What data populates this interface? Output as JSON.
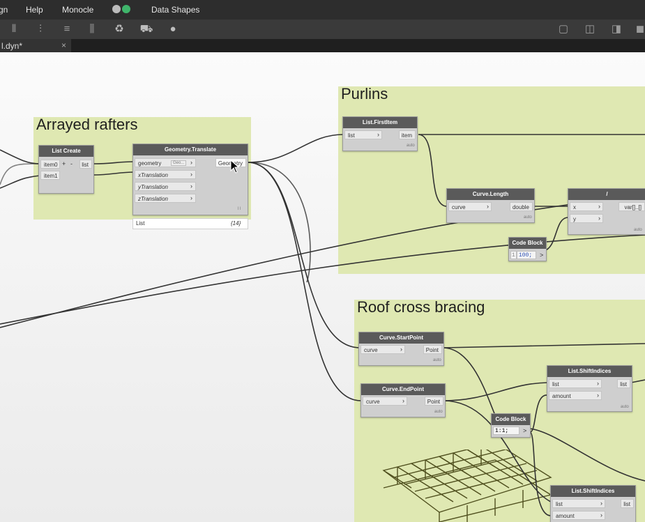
{
  "menu": {
    "items": [
      "gn",
      "Help",
      "Monocle",
      "Data Shapes"
    ]
  },
  "toolbar": {
    "icons_left": [
      "align-left-icon",
      "align-center-icon",
      "align-top-icon",
      "align-middle-icon",
      "recycle-icon",
      "cart-icon",
      "bomb-icon"
    ],
    "icons_right": [
      "cube-outline-icon",
      "cube-icon",
      "cube-export-icon",
      "cube-solid-icon"
    ]
  },
  "tab": {
    "label": "l.dyn*",
    "close": "×"
  },
  "groups": {
    "arrayed": "Arrayed rafters",
    "purlins": "Purlins",
    "bracing": "Roof cross bracing"
  },
  "nodes": {
    "list_create": {
      "title": "List Create",
      "in0": "item0",
      "in1": "item1",
      "add": "+",
      "remove": "-",
      "out": "list"
    },
    "translate": {
      "title": "Geometry.Translate",
      "in0": "geometry",
      "in0_type": "Geo...",
      "in1": "xTranslation",
      "in2": "yTranslation",
      "in3": "zTranslation",
      "out": "Geometry",
      "lacing": "l l",
      "preview_label": "List",
      "preview_count": "{14}"
    },
    "first_item": {
      "title": "List.FirstItem",
      "in0": "list",
      "out": "item",
      "lacing": "auto"
    },
    "curve_length": {
      "title": "Curve.Length",
      "in0": "curve",
      "out": "double",
      "lacing": "auto"
    },
    "div": {
      "title": "/",
      "in0": "x",
      "in1": "y",
      "out": "var[]..[]",
      "lacing": "auto"
    },
    "code1": {
      "title": "Code Block",
      "line_no": "1",
      "code": "100;",
      "out": ">"
    },
    "start_point": {
      "title": "Curve.StartPoint",
      "in0": "curve",
      "out": "Point",
      "lacing": "auto"
    },
    "end_point": {
      "title": "Curve.EndPoint",
      "in0": "curve",
      "out": "Point",
      "lacing": "auto"
    },
    "shift1": {
      "title": "List.ShiftIndices",
      "in0": "list",
      "in1": "amount",
      "out": "list",
      "lacing": "auto"
    },
    "code2": {
      "title": "Code Block",
      "code": "1:1;",
      "out": ">"
    },
    "shift2": {
      "title": "List.ShiftIndices",
      "in0": "list",
      "in1": "amount",
      "out": "list"
    }
  },
  "colors": {
    "group": "#dfe8b2",
    "node_header": "#5a5a5a",
    "wire": "#333333",
    "menubar": "#2d2d2d",
    "mesh": "#4f4f1e"
  }
}
